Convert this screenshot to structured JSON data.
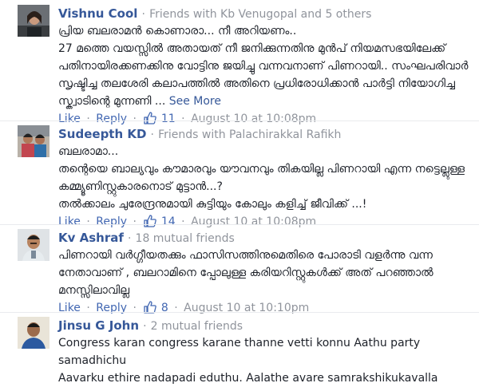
{
  "comments": [
    {
      "author": "Vishnu Cool",
      "context": "Friends with Kb Venugopal and 5 others",
      "lines": [
        "പ്രിയ ബലരാമൻ കൊണാരാ... നീ അറിയണം..",
        "27 മത്തെ വയസ്സിൽ അതായത് നീ ജനിക്കുന്നതിനു മുൻപ് നിയമസഭയിലേക്ക്",
        "പതിനായിരക്കണക്കിനു വോട്ടിനു ജയിച്ചു വന്നവനാണ് പിണറായി.. സംഘപരിവാർ",
        "സൃഷ്ടിച്ച തലശേരി കലാപത്തിൽ അതിനെ പ്രധിരോധിക്കാൻ പാർട്ടി നിയോഗിച്ച",
        "സ്ക്വാടിന്റെ മുന്നണി ..."
      ],
      "see_more": "See More",
      "like_label": "Like",
      "reply_label": "Reply",
      "likes": "11",
      "timestamp": "August 10 at 10:08pm"
    },
    {
      "author": "Sudeepth KD",
      "context": "Friends with Palachirakkal Rafikh",
      "lines": [
        "ബലരാമാ...",
        "തന്റെയെ ബാല്യവും കൗമാരവും യൗവനവും തികയില്ല പിണറായി എന്ന നട്ടെല്ലുള്ള",
        "കമ്മ്യൂണിസ്റ്റുകാരനൊട് മുട്ടാൻ...?",
        "തൽക്കാലം ചുരേന്ദ്രനുമായി കുട്ടിയും കോലും കളിച്ച് ജീവിക്ക് ...!"
      ],
      "like_label": "Like",
      "reply_label": "Reply",
      "likes": "14",
      "timestamp": "August 10 at 10:08pm"
    },
    {
      "author": "Kv Ashraf",
      "context": "18 mutual friends",
      "lines": [
        "പിണറായി വർഗ്ഗീയതക്കും ഫാസിസത്തിനുമെതിരെ പോരാടി വളർന്നു വന്ന",
        "നേതാവാണ് , ബലറാമിനെ പ്പോലുള്ള കരിയറിസ്റ്റുകൾക്ക് അത് പറഞ്ഞാൽ",
        "മനസ്സിലാവില്ല"
      ],
      "like_label": "Like",
      "reply_label": "Reply",
      "likes": "8",
      "timestamp": "August 10 at 10:10pm"
    },
    {
      "author": "Jinsu G John",
      "context": "2 mutual friends",
      "lines": [
        "Congress karan congress karane thanne vetti konnu Aathu party samadhichu",
        "Aavarku ethire nadapadi eduthu. Aalathe avare samrakshikukavalla"
      ]
    }
  ],
  "separator": "·",
  "colors": {
    "link": "#365899",
    "meta": "#90949c",
    "action": "#4267b2",
    "text": "#1d2129"
  }
}
